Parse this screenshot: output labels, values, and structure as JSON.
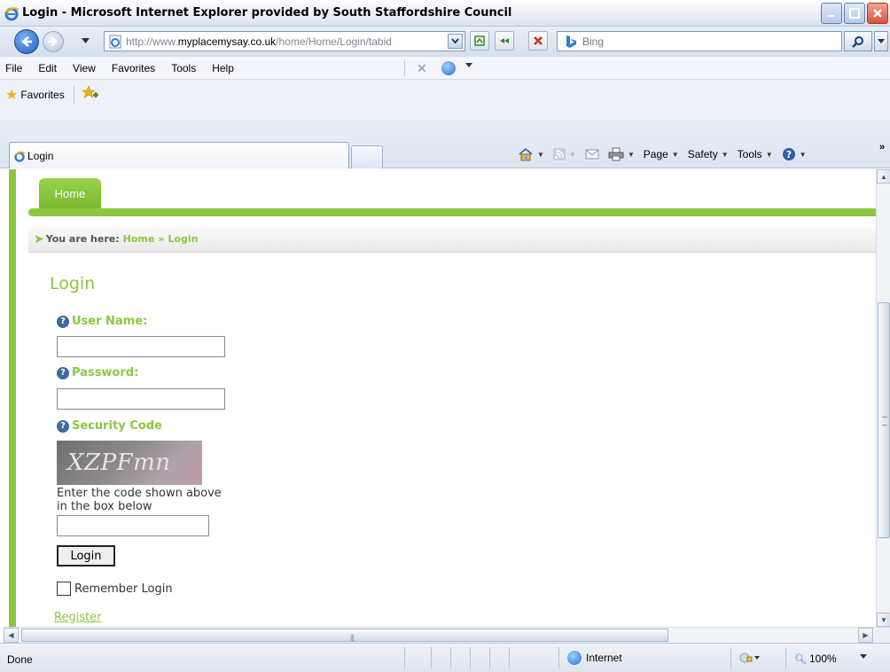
{
  "window": {
    "title": "Login - Microsoft Internet Explorer provided by South Staffordshire Council"
  },
  "address": {
    "url_prefix": "http://www.",
    "url_domain": "myplacemysay.co.uk",
    "url_path": "/home/Home/Login/tabid"
  },
  "search": {
    "placeholder": "Bing"
  },
  "menu": {
    "items": [
      "File",
      "Edit",
      "View",
      "Favorites",
      "Tools",
      "Help"
    ]
  },
  "favorites_bar": {
    "label": "Favorites"
  },
  "tab": {
    "label": "Login"
  },
  "command_bar": {
    "page": "Page",
    "safety": "Safety",
    "tools": "Tools"
  },
  "site": {
    "nav_home": "Home",
    "breadcrumb": {
      "prefix": "You are here:",
      "home": "Home",
      "separator": "»",
      "current": "Login"
    }
  },
  "login_form": {
    "title": "Login",
    "username_label": "User Name:",
    "username_value": "",
    "password_label": "Password:",
    "security_label": "Security Code",
    "captcha_text": "XZPFmn",
    "captcha_hint": "Enter the code shown above in the box below",
    "login_button": "Login",
    "remember_label": "Remember Login",
    "register_link": "Register"
  },
  "status_bar": {
    "status": "Done",
    "zone": "Internet",
    "zoom": "100%"
  },
  "colors": {
    "site_green": "#8cc63f",
    "help_blue": "#3d6aa0"
  }
}
